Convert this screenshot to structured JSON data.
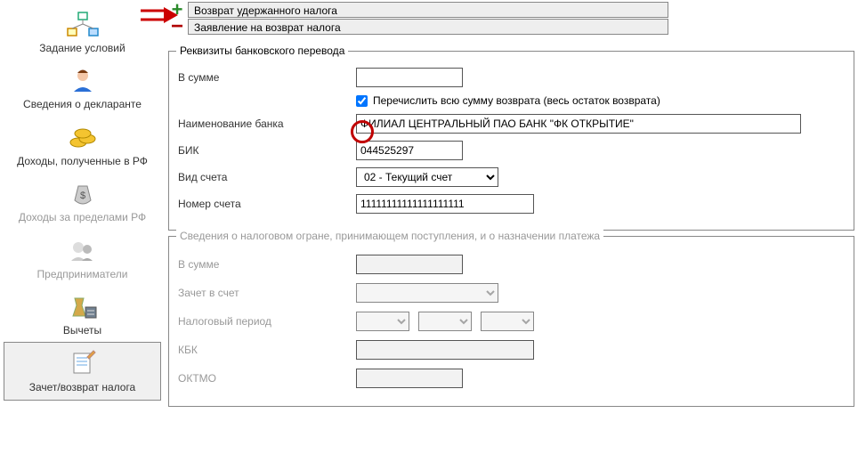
{
  "sidebar": {
    "items": [
      {
        "label": "Задание условий"
      },
      {
        "label": "Сведения о декларанте"
      },
      {
        "label": "Доходы, полученные в РФ"
      },
      {
        "label": "Доходы за пределами РФ"
      },
      {
        "label": "Предприниматели"
      },
      {
        "label": "Вычеты"
      },
      {
        "label": "Зачет/возврат налога"
      }
    ]
  },
  "top_rows": {
    "row1": "Возврат удержанного налога",
    "row2": "Заявление на возврат налога"
  },
  "fieldset1": {
    "legend": "Реквизиты банковского перевода",
    "amount_label": "В сумме",
    "amount_value": "",
    "transfer_all_label": "Перечислить всю сумму возврата (весь остаток возврата)",
    "bank_name_label": "Наименование банка",
    "bank_name_value": "ФИЛИАЛ ЦЕНТРАЛЬНЫЙ ПАО БАНК \"ФК ОТКРЫТИЕ\"",
    "bik_label": "БИК",
    "bik_value": "044525297",
    "account_type_label": "Вид счета",
    "account_type_value": "02 - Текущий счет",
    "account_number_label": "Номер счета",
    "account_number_value": "11111111111111111111"
  },
  "fieldset2": {
    "legend": "Сведения о налоговом огране, принимающем поступления, и о назначении платежа",
    "amount_label": "В сумме",
    "offset_label": "Зачет в счет",
    "tax_period_label": "Налоговый период",
    "kbk_label": "КБК",
    "oktmo_label": "ОКТМО"
  }
}
